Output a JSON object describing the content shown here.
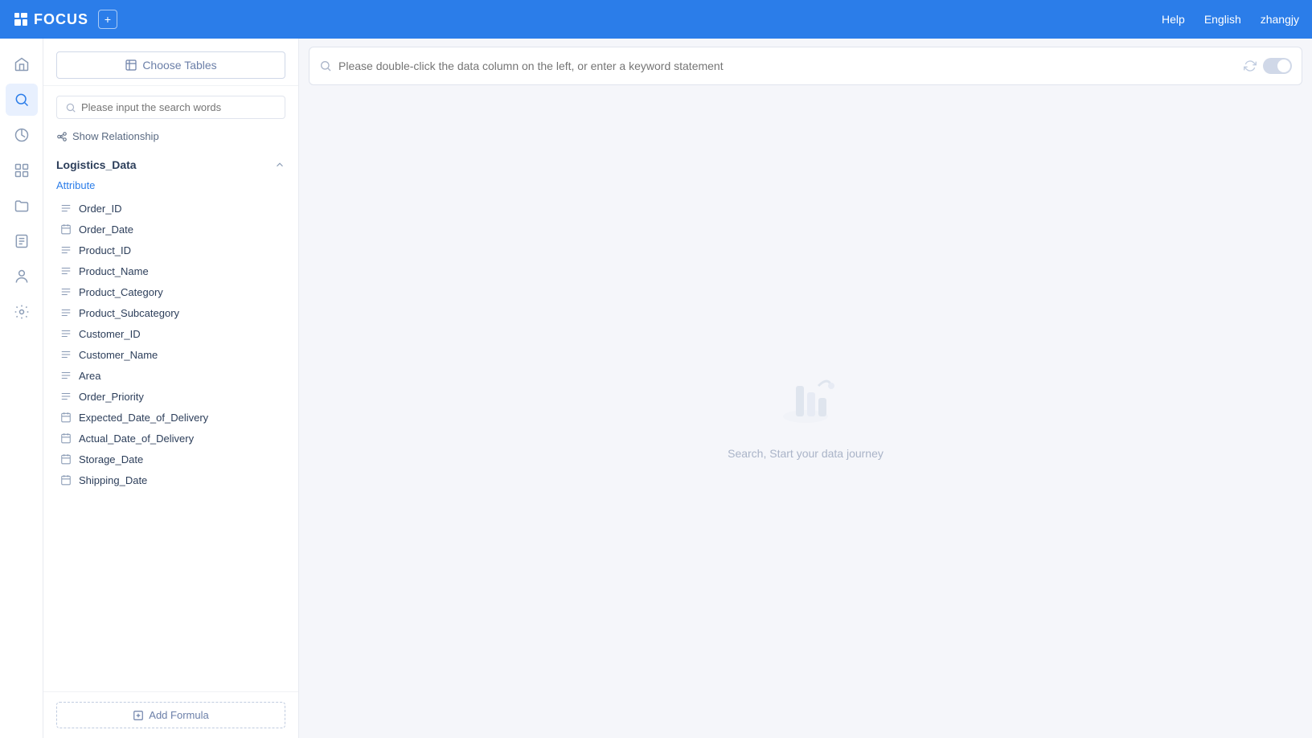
{
  "topNav": {
    "appName": "FOCUS",
    "plusTitle": "+",
    "helpLabel": "Help",
    "langLabel": "English",
    "userLabel": "zhangjy"
  },
  "iconSidebar": {
    "items": [
      {
        "name": "home-icon",
        "symbol": "⌂"
      },
      {
        "name": "search-icon",
        "symbol": "⌕"
      },
      {
        "name": "chart-icon",
        "symbol": "◎"
      },
      {
        "name": "grid-icon",
        "symbol": "⊞"
      },
      {
        "name": "folder-icon",
        "symbol": "⊟"
      },
      {
        "name": "report-icon",
        "symbol": "≡"
      },
      {
        "name": "user-icon",
        "symbol": "⊙"
      },
      {
        "name": "settings-icon",
        "symbol": "⚙"
      }
    ]
  },
  "dataPanel": {
    "chooseTablesLabel": "Choose Tables",
    "searchPlaceholder": "Please input the search words",
    "showRelationshipLabel": "Show Relationship",
    "tableName": "Logistics_Data",
    "attributeLabel": "Attribute",
    "fields": [
      {
        "name": "Order_ID",
        "type": "text"
      },
      {
        "name": "Order_Date",
        "type": "date"
      },
      {
        "name": "Product_ID",
        "type": "text"
      },
      {
        "name": "Product_Name",
        "type": "text"
      },
      {
        "name": "Product_Category",
        "type": "text"
      },
      {
        "name": "Product_Subcategory",
        "type": "text"
      },
      {
        "name": "Customer_ID",
        "type": "text"
      },
      {
        "name": "Customer_Name",
        "type": "text"
      },
      {
        "name": "Area",
        "type": "text"
      },
      {
        "name": "Order_Priority",
        "type": "text"
      },
      {
        "name": "Expected_Date_of_Delivery",
        "type": "date"
      },
      {
        "name": "Actual_Date_of_Delivery",
        "type": "date"
      },
      {
        "name": "Storage_Date",
        "type": "date"
      },
      {
        "name": "Shipping_Date",
        "type": "date"
      }
    ],
    "addFormulaLabel": "Add Formula"
  },
  "queryBar": {
    "placeholder": "Please double-click the data column on the left, or enter a keyword statement"
  },
  "emptyState": {
    "text": "Search, Start your data journey"
  }
}
